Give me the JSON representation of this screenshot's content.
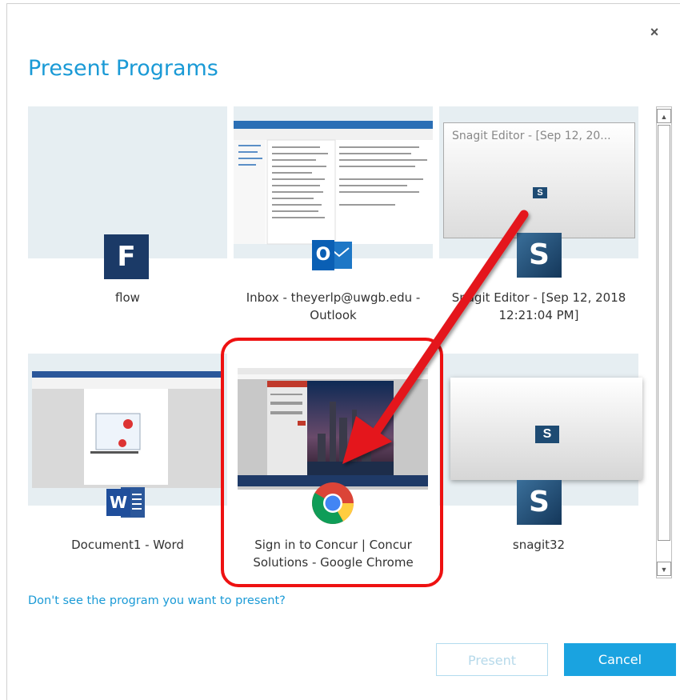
{
  "dialog": {
    "title": "Present Programs",
    "close_label": "×",
    "help_link": "Don't see the program you want to present?",
    "present_button": "Present",
    "cancel_button": "Cancel"
  },
  "programs": [
    {
      "label": "flow",
      "icon": "flow-icon"
    },
    {
      "label": "Inbox - theyerlp@uwgb.edu - Outlook",
      "icon": "outlook-icon"
    },
    {
      "label": "Snagit Editor - [Sep 12, 2018 12:21:04 PM]",
      "icon": "snagit-icon",
      "thumb_title": "Snagit Editor - [Sep 12, 20..."
    },
    {
      "label": "Document1 - Word",
      "icon": "word-icon"
    },
    {
      "label": "Sign in to Concur | Concur Solutions - Google Chrome",
      "icon": "chrome-icon"
    },
    {
      "label": "snagit32",
      "icon": "snagit-icon"
    }
  ],
  "icons": {
    "flow": "F",
    "outlook": "O",
    "word": "W",
    "snagit": "S"
  },
  "colors": {
    "accent": "#1a9ad6",
    "highlight": "#e11111",
    "thumb_bg": "#e6eef2"
  }
}
